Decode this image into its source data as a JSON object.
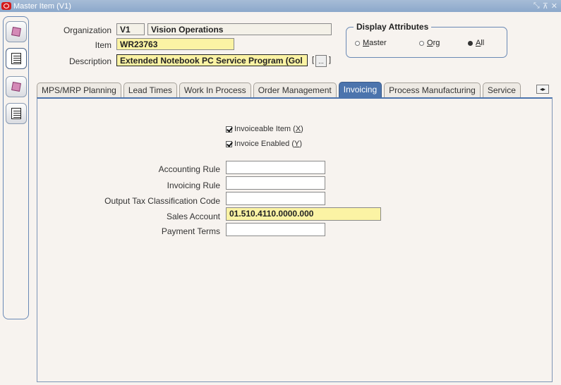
{
  "window": {
    "title": "Master Item (V1)",
    "controls": [
      "⤡",
      "⊼",
      "✕"
    ]
  },
  "header": {
    "organization_label": "Organization",
    "organization_code": "V1",
    "organization_name": "Vision Operations",
    "item_label": "Item",
    "item_value": "WR23763",
    "description_label": "Description",
    "description_value": "Extended Notebook PC Service Program (Gol",
    "lov_button": "...",
    "bracket_left": "[",
    "bracket_right": "]"
  },
  "display_attributes": {
    "legend": "Display Attributes",
    "options": [
      {
        "pre": "",
        "u": "M",
        "post": "aster",
        "selected": false
      },
      {
        "pre": "",
        "u": "O",
        "post": "rg",
        "selected": false
      },
      {
        "pre": "",
        "u": "A",
        "post": "ll",
        "selected": true
      }
    ]
  },
  "tabs": [
    {
      "label": "MPS/MRP Planning",
      "active": false
    },
    {
      "label": "Lead Times",
      "active": false
    },
    {
      "label": "Work In Process",
      "active": false
    },
    {
      "label": "Order Management",
      "active": false
    },
    {
      "label": "Invoicing",
      "active": true
    },
    {
      "label": "Process Manufacturing",
      "active": false
    },
    {
      "label": "Service",
      "active": false
    }
  ],
  "tab_scroll": "◂▸",
  "invoicing": {
    "invoiceable_item": {
      "label_pre": "Invoiceable Item (",
      "key": "X",
      "label_post": ")",
      "checked": true
    },
    "invoice_enabled": {
      "label_pre": "Invoice Enabled (",
      "key": "Y",
      "label_post": ")",
      "checked": true
    },
    "accounting_rule": {
      "label": "Accounting Rule",
      "value": ""
    },
    "invoicing_rule": {
      "label": "Invoicing Rule",
      "value": ""
    },
    "output_tax": {
      "label": "Output Tax Classification Code",
      "value": ""
    },
    "sales_account": {
      "label": "Sales Account",
      "value": "01.510.4110.0000.000"
    },
    "payment_terms": {
      "label": "Payment Terms",
      "value": ""
    }
  }
}
